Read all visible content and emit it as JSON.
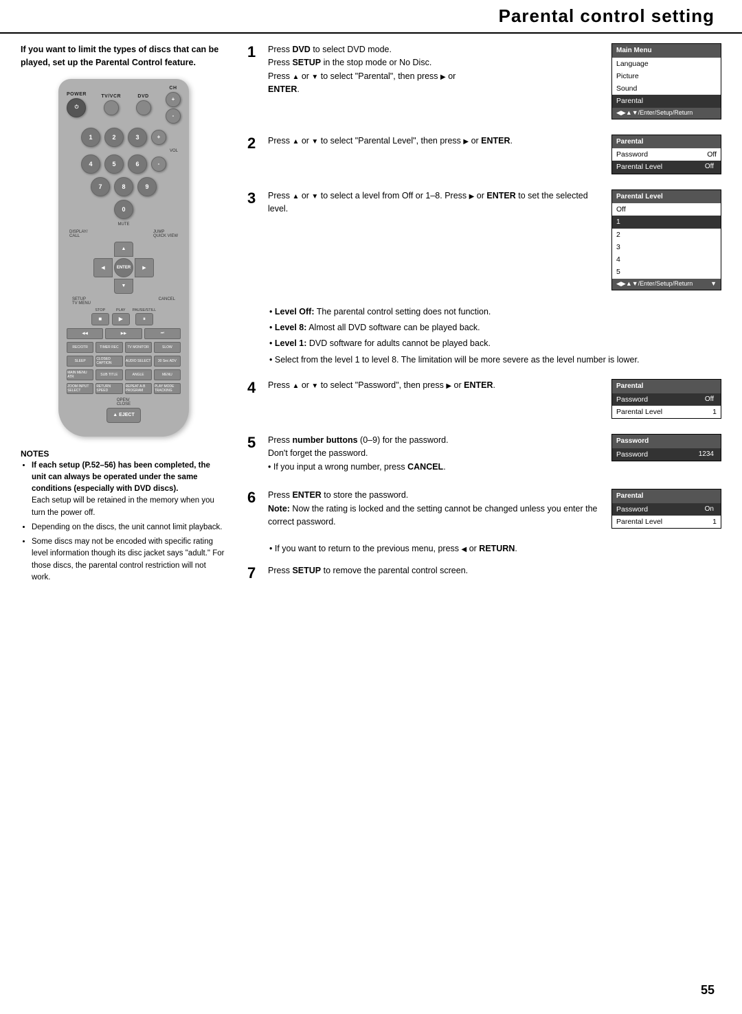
{
  "page": {
    "title": "Parental control setting",
    "page_number": "55"
  },
  "left_col": {
    "intro_text_bold": "If you want to limit the types of discs that can be played, set up the Parental Control feature.",
    "notes_title": "NOTES",
    "notes_items": [
      "If each setup (P.52–56) has been completed, the unit can always be operated under the same conditions (especially with DVD discs). Each setup will be retained in the memory when you turn the power off.",
      "Depending on the discs, the unit cannot limit playback.",
      "Some discs may not be encoded with specific rating level information though its disc jacket says \"adult.\" For those discs, the parental control restriction will not work."
    ]
  },
  "remote": {
    "labels": {
      "power": "POWER",
      "tvvcr": "TV/VCR",
      "dvd": "DVD",
      "ch": "CH",
      "vol": "VOL",
      "mute": "MUTE",
      "display_call": "DISPLAY/CALL",
      "jump_quick_view": "JUMP QUICK VIEW",
      "setup_tv_menu": "SETUP TV MENU",
      "cancel": "CANCEL",
      "stop": "STOP",
      "play": "PLAY",
      "pause_still": "PAUSE/STILL",
      "enter": "ENTER",
      "eject": "EJECT",
      "open_close": "OPEN/CLOSE"
    }
  },
  "steps": [
    {
      "number": "1",
      "text_parts": [
        {
          "text": "DVD",
          "bold": true,
          "prefix": "Press ",
          "suffix": " to select DVD mode."
        },
        {
          "text": "SETUP",
          "bold": true,
          "prefix": "Press ",
          "suffix": " in the stop mode or No Disc."
        },
        {
          "text": "",
          "prefix": "Press ",
          "suffix": " or  to select \"Parental\", then press  or"
        },
        {
          "text": "ENTER",
          "bold": true,
          "prefix": "",
          "suffix": "."
        }
      ],
      "screen": {
        "title": "Main Menu",
        "rows": [
          {
            "label": "Language",
            "highlighted": false
          },
          {
            "label": "Picture",
            "highlighted": false
          },
          {
            "label": "Sound",
            "highlighted": false
          },
          {
            "label": "Parental",
            "highlighted": true
          }
        ],
        "footer": "◀▶▲▼/Enter/Setup/Return"
      }
    },
    {
      "number": "2",
      "text": "Press ▲ or ▼ to select \"Parental Level\", then press ▶ or ENTER.",
      "screen": {
        "title": "Parental",
        "rows_kv": [
          {
            "key": "Password",
            "val": "Off",
            "highlighted": false
          },
          {
            "key": "Parental Level",
            "val": "Off",
            "highlighted": true
          }
        ]
      }
    },
    {
      "number": "3",
      "text": "Press ▲ or ▼ to select a level from Off or 1–8. Press ▶ or ENTER to set the selected level.",
      "screen": {
        "title": "Parental Level",
        "rows": [
          {
            "label": "Off",
            "highlighted": false
          },
          {
            "label": "1",
            "highlighted": true
          },
          {
            "label": "2",
            "highlighted": false
          },
          {
            "label": "3",
            "highlighted": false
          },
          {
            "label": "4",
            "highlighted": false
          },
          {
            "label": "5",
            "highlighted": false
          }
        ],
        "footer": "◀▶▲▼/Enter/Setup/Return"
      }
    },
    {
      "number": "4",
      "text": "Press ▲ or ▼ to select \"Password\", then press ▶ or ENTER.",
      "screen": {
        "title": "Parental",
        "rows_kv": [
          {
            "key": "Password",
            "val": "Off",
            "highlighted": true
          },
          {
            "key": "Parental Level",
            "val": "1",
            "highlighted": false
          }
        ]
      }
    },
    {
      "number": "5",
      "text_bold": "number buttons",
      "text_prefix": "Press ",
      "text_suffix": " (0–9) for the password.",
      "text_extra": "Don't forget the password.",
      "text_bullet": "If you input a wrong number, press CANCEL.",
      "text_bullet_bold": "CANCEL",
      "screen": {
        "title": "Password",
        "rows_kv": [
          {
            "key": "Password",
            "val": "1234",
            "highlighted": true
          }
        ]
      }
    },
    {
      "number": "6",
      "text_bold": "ENTER",
      "text_prefix": "Press ",
      "text_suffix": " to store the password.",
      "note_bold": "Note:",
      "note_text": " Now the rating is locked and the setting cannot be changed unless you enter the correct password.",
      "screen": {
        "title": "Parental",
        "rows_kv": [
          {
            "key": "Password",
            "val": "On",
            "highlighted": true
          },
          {
            "key": "Parental Level",
            "val": "1",
            "highlighted": false
          }
        ]
      }
    }
  ],
  "bullet_notes_step3": [
    {
      "label": "Level Off:",
      "text": "The parental control setting does not function."
    },
    {
      "label": "Level 8:",
      "text": "Almost all DVD software can be played back."
    },
    {
      "label": "Level 1:",
      "text": "DVD software for adults cannot be played back."
    },
    {
      "text": "Select from the level 1 to level 8. The limitation will be more severe as the level number is lower."
    }
  ],
  "prev_menu_note": "If you want to return to the previous menu, press ◀ or RETURN.",
  "prev_menu_bold": "RETURN",
  "step7": {
    "number": "7",
    "text_prefix": "Press ",
    "text_bold": "SETUP",
    "text_suffix": " to remove the parental control screen."
  }
}
